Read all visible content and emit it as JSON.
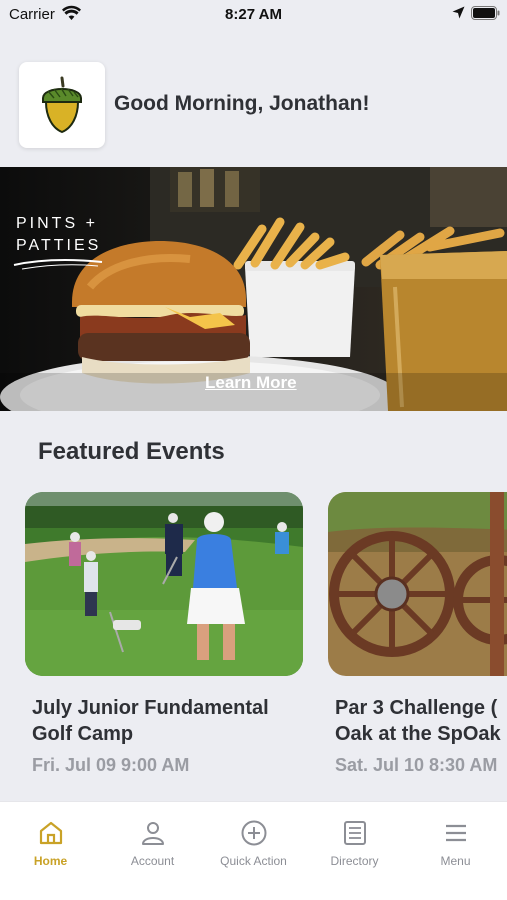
{
  "status_bar": {
    "carrier": "Carrier",
    "time": "8:27 AM"
  },
  "header": {
    "greeting": "Good Morning, Jonathan!",
    "logo_icon": "acorn-icon"
  },
  "banner": {
    "brand_line1": "PINTS +",
    "brand_line2": "PATTIES",
    "cta": "Learn More"
  },
  "featured": {
    "title": "Featured Events",
    "events": [
      {
        "title": "July Junior Fundamental\nGolf Camp",
        "date": "Fri. Jul 09 9:00 AM"
      },
      {
        "title": "Par 3 Challenge (\nOak at the SpOak",
        "date": "Sat. Jul 10 8:30 AM"
      }
    ]
  },
  "tabs": [
    {
      "label": "Home",
      "icon": "home-icon"
    },
    {
      "label": "Account",
      "icon": "person-icon"
    },
    {
      "label": "Quick Action",
      "icon": "plus-circle-icon"
    },
    {
      "label": "Directory",
      "icon": "list-icon"
    },
    {
      "label": "Menu",
      "icon": "hamburger-icon"
    }
  ],
  "colors": {
    "accent": "#c9a227",
    "background": "#ecedf2",
    "inactive": "#8c8e95"
  }
}
